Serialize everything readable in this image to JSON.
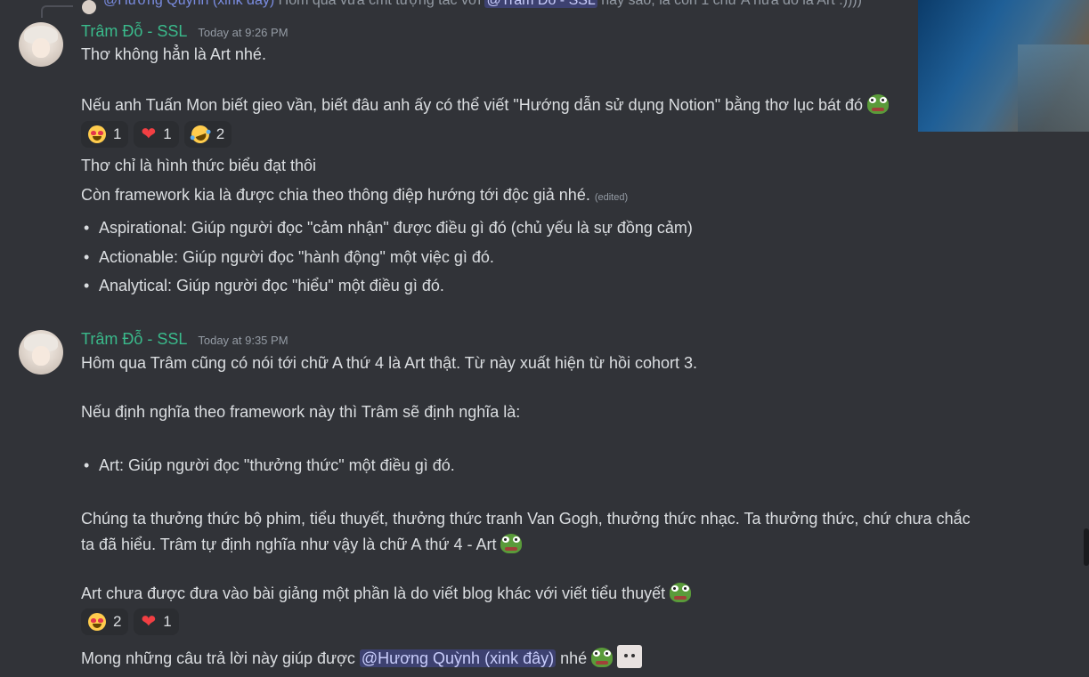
{
  "reply": {
    "author": "@Hương Quỳnh (xink đây)",
    "text_before": "Hôm qua vừa cmt tượng tác với",
    "mention": "@Trâm Đỗ - SSL",
    "text_after": "hay sao, là còn 1 chữ A nữa đó là Art :))))"
  },
  "message1": {
    "author": "Trâm Đỗ - SSL",
    "timestamp": "Today at 9:26 PM",
    "lines": [
      "Thơ không hẳn là Art nhé.",
      "Nếu anh Tuấn Mon biết gieo vần, biết đâu anh ấy có thể viết \"Hướng dẫn sử dụng Notion\" bằng thơ lục bát đó"
    ],
    "reactions": [
      {
        "emoji": "heart-eyes-icon",
        "count": "1"
      },
      {
        "emoji": "heart-icon",
        "count": "1"
      },
      {
        "emoji": "rofl-icon",
        "count": "2"
      }
    ],
    "follow_up": "Thơ chỉ là hình thức biểu đạt thôi",
    "framework_line": "Còn framework kia là được chia theo thông điệp hướng tới độc giả nhé.",
    "edited": "(edited)",
    "bullets": [
      "Aspirational: Giúp người đọc \"cảm nhận\" được điều gì đó (chủ yếu là sự đồng cảm)",
      "Actionable: Giúp người đọc \"hành động\" một việc gì đó.",
      "Analytical: Giúp người đọc \"hiểu\" một điều gì đó."
    ]
  },
  "message2": {
    "author": "Trâm Đỗ - SSL",
    "timestamp": "Today at 9:35 PM",
    "line1": "Hôm qua Trâm cũng có nói tới chữ A thứ 4 là Art thật. Từ này xuất hiện từ hồi cohort 3.",
    "line2": "Nếu định nghĩa theo framework này thì Trâm sẽ định nghĩa là:",
    "bullet": "Art: Giúp người đọc \"thưởng thức\" một điều gì đó.",
    "para1": "Chúng ta thưởng thức bộ phim, tiểu thuyết, thưởng thức tranh Van Gogh, thưởng thức nhạc. Ta thưởng thức, chứ chưa chắc",
    "para1b": "ta đã hiểu. Trâm tự định nghĩa như vậy là chữ A thứ 4 - Art",
    "para2": "Art chưa được đưa vào bài giảng một phần là do viết blog khác với viết tiểu thuyết",
    "reactions": [
      {
        "emoji": "heart-eyes-icon",
        "count": "2"
      },
      {
        "emoji": "heart-icon",
        "count": "1"
      }
    ],
    "closing_before": "Mong những câu trả lời này giúp được",
    "closing_mention": "@Hương Quỳnh (xink đây)",
    "closing_after": "nhé"
  }
}
